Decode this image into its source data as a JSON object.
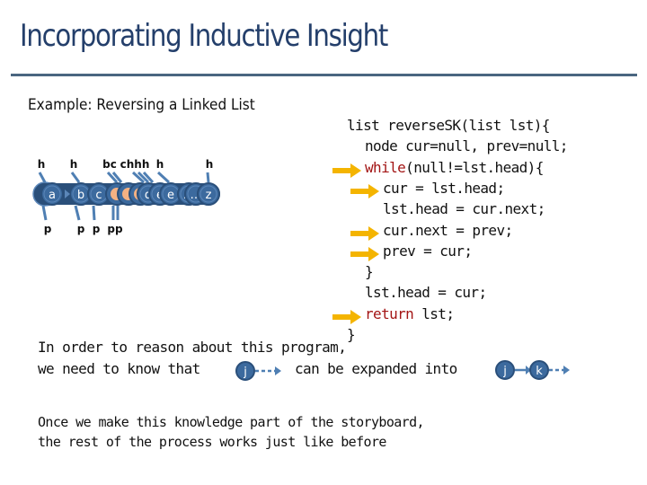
{
  "slide": {
    "title": "Incorporating Inductive Insight",
    "subtitle": "Example: Reversing a Linked List"
  },
  "diagram": {
    "description": "overlapping animation frames of a linked list being reversed",
    "nodes": [
      "a",
      "b",
      "c",
      "",
      "",
      "",
      "d",
      "e",
      "e",
      "…",
      "…",
      "z"
    ],
    "top_labels": [
      "h",
      "h",
      "h",
      "hc",
      "chhh",
      "h",
      "h"
    ],
    "bottom_labels": [
      "p",
      "p",
      "p",
      "p",
      "pp"
    ],
    "colors": {
      "node_fill": "#3c6a9e",
      "node_border": "#2a4f7a",
      "node_inner_ring": "#5b86b8",
      "placeholder_dot": "#f4b183",
      "pointer_arrow": "#4f7fb3"
    }
  },
  "code": {
    "lines": [
      {
        "indent": 0,
        "parts": [
          {
            "t": "list reverseSK(list lst){"
          }
        ]
      },
      {
        "indent": 1,
        "parts": [
          {
            "t": "node cur=null, prev=null;"
          }
        ]
      },
      {
        "indent": 1,
        "parts": [
          {
            "t": "while",
            "kw": true
          },
          {
            "t": "(null!=lst.head){"
          }
        ]
      },
      {
        "indent": 2,
        "parts": [
          {
            "t": "cur = lst.head;"
          }
        ]
      },
      {
        "indent": 2,
        "parts": [
          {
            "t": "lst.head = cur.next;"
          }
        ]
      },
      {
        "indent": 2,
        "parts": [
          {
            "t": "cur.next = prev;"
          }
        ]
      },
      {
        "indent": 2,
        "parts": [
          {
            "t": "prev = cur;"
          }
        ]
      },
      {
        "indent": 1,
        "parts": [
          {
            "t": "}"
          }
        ]
      },
      {
        "indent": 1,
        "parts": [
          {
            "t": "lst.head = cur;"
          }
        ]
      },
      {
        "indent": 1,
        "parts": [
          {
            "t": "return",
            "kw": true
          },
          {
            "t": " lst;"
          }
        ]
      },
      {
        "indent": 0,
        "parts": [
          {
            "t": "}"
          }
        ]
      }
    ],
    "arrow_markers_at_lines": [
      2,
      3,
      5,
      6,
      9
    ],
    "arrow_color": "#f4b400",
    "keyword_color": "#a31515"
  },
  "insight": {
    "line1": "In order to reason about this program,",
    "line2_a": "we need to know that",
    "line2_b": "can be expanded into",
    "node_j": "j",
    "node_k": "k"
  },
  "conclusion": {
    "line1": "Once we make this knowledge part of the storyboard,",
    "line2": "the rest of the process works just like before"
  }
}
